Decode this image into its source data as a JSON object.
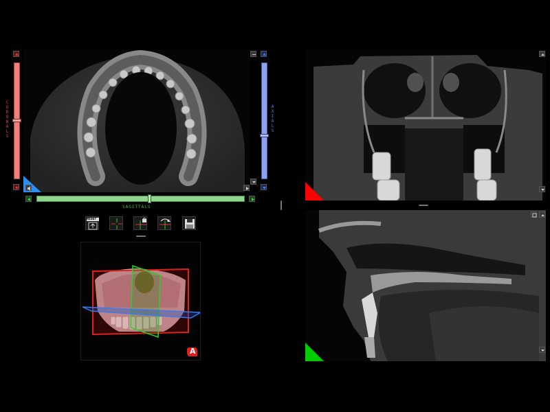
{
  "axial_panel": {
    "left_slider_label": "CORONALS",
    "right_slider_label": "AXIALS",
    "bottom_slider_label": "SAGITTALS",
    "coronal_color": "#f08080",
    "axial_color": "#8ea2f0",
    "sagittal_color": "#8fd48f",
    "coronal_slider_level": 0.5,
    "axial_slider_level": 0.64,
    "sagittal_slider_level": 0.54
  },
  "toolbar": {
    "reset_label": "RESET",
    "buttons": [
      "reset-view",
      "crosshair",
      "lock-crosshair",
      "rotate-crosshair",
      "save"
    ]
  },
  "viewer_3d": {
    "orientation_badge": "A",
    "badge_color": "#e02020"
  },
  "coronal_view": {
    "corner_marker_color": "#ff0000"
  },
  "sagittal_view": {
    "corner_marker_color": "#00cc00"
  },
  "axial_view": {
    "corner_marker_color": "#2b8ef0"
  }
}
